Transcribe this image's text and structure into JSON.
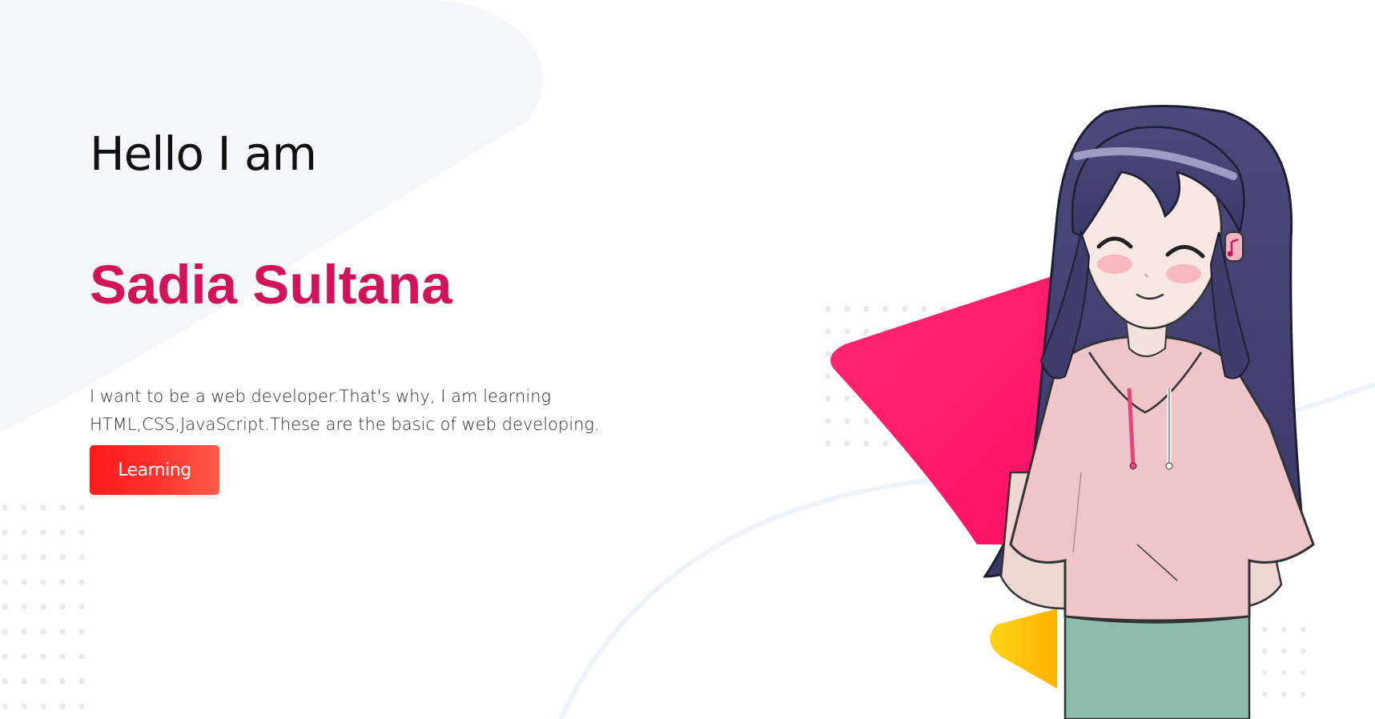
{
  "hero": {
    "greeting": "Hello I am",
    "name": "Sadia Sultana",
    "description_line1": "I want to be a web developer.That's why, I am learning",
    "description_line2": "HTML,CSS,JavaScript.These are the basic of web developing.",
    "button_label": "Learning"
  },
  "colors": {
    "name": "#d2125a",
    "button": "#ff1a1a",
    "triangle_pink": "#ff1f6e",
    "triangle_yellow": "#ffc21a"
  },
  "illustration": {
    "icon": "anime-girl-pink-hoodie-illustration"
  }
}
